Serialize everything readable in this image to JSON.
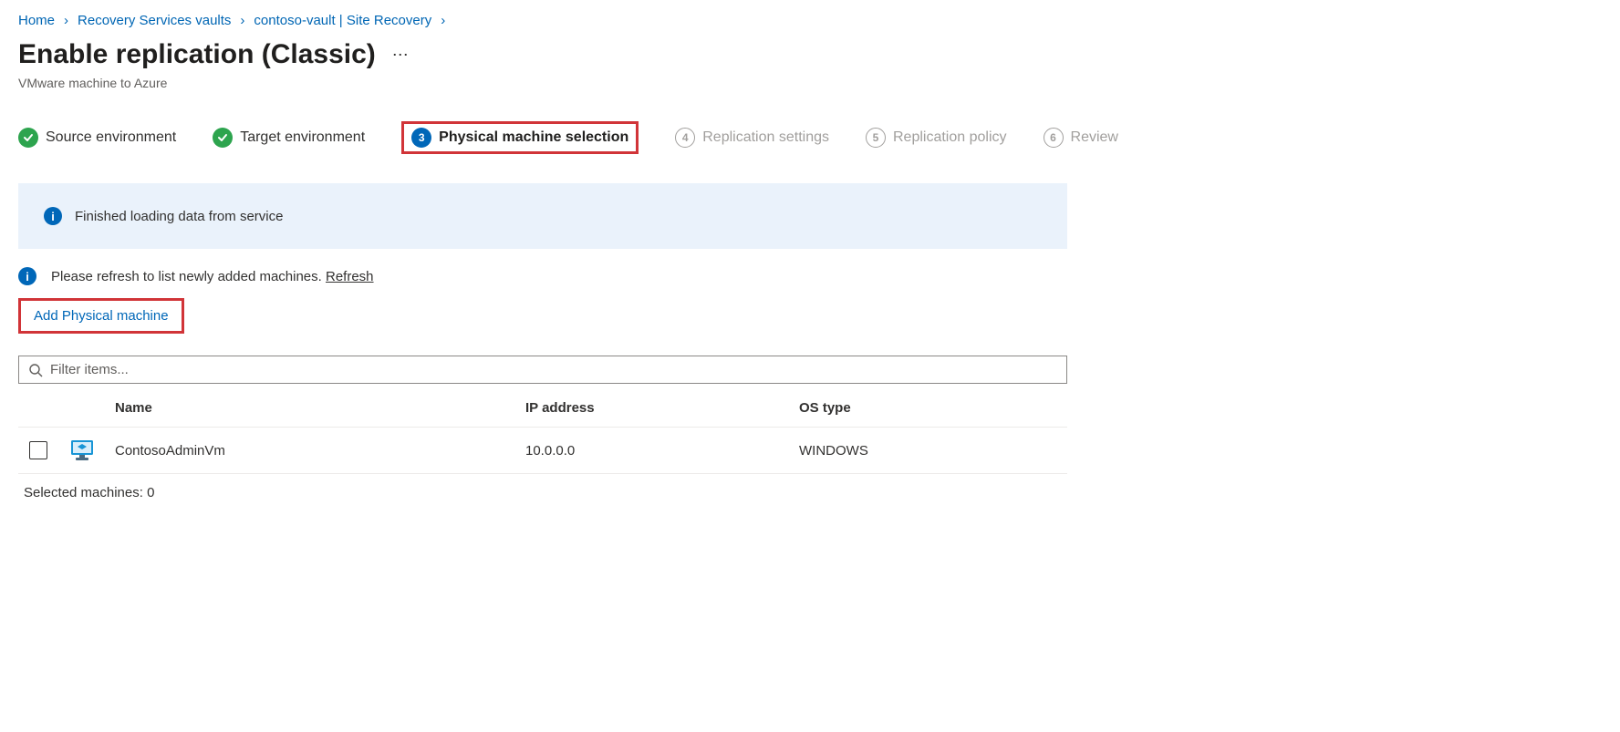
{
  "breadcrumb": {
    "items": [
      {
        "label": "Home"
      },
      {
        "label": "Recovery Services vaults"
      },
      {
        "label": "contoso-vault | Site Recovery"
      }
    ]
  },
  "header": {
    "title": "Enable replication (Classic)",
    "subtitle": "VMware machine to Azure"
  },
  "steps": [
    {
      "num": "1",
      "label": "Source environment",
      "state": "done"
    },
    {
      "num": "2",
      "label": "Target environment",
      "state": "done"
    },
    {
      "num": "3",
      "label": "Physical machine selection",
      "state": "current"
    },
    {
      "num": "4",
      "label": "Replication settings",
      "state": "future"
    },
    {
      "num": "5",
      "label": "Replication policy",
      "state": "future"
    },
    {
      "num": "6",
      "label": "Review",
      "state": "future"
    }
  ],
  "infobar": {
    "message": "Finished loading data from service"
  },
  "refresh_note": {
    "text": "Please refresh to list newly added machines.",
    "link": "Refresh"
  },
  "add_link": "Add Physical machine",
  "filter": {
    "placeholder": "Filter items..."
  },
  "table": {
    "columns": {
      "name": "Name",
      "ip": "IP address",
      "os": "OS type"
    },
    "rows": [
      {
        "name": "ContosoAdminVm",
        "ip": "10.0.0.0",
        "os": "WINDOWS"
      }
    ]
  },
  "selected": {
    "label_prefix": "Selected machines: ",
    "count": "0"
  }
}
